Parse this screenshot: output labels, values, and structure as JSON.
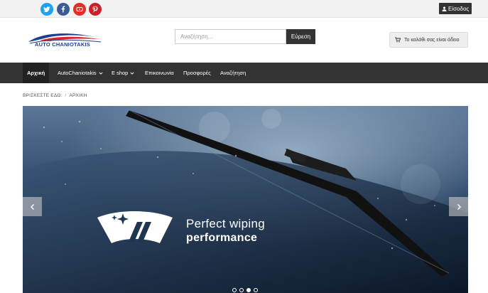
{
  "topbar": {
    "social": [
      {
        "name": "twitter-icon"
      },
      {
        "name": "facebook-icon"
      },
      {
        "name": "youtube-icon"
      },
      {
        "name": "pinterest-icon"
      }
    ],
    "login_label": "Είσοδος"
  },
  "header": {
    "logo_text_auto": "AUTO",
    "logo_text_brand": "CHANIOTAKIS",
    "search_placeholder": "Αναζήτηση...",
    "search_button": "Εύρεση",
    "cart_label": "Το καλάθι σας είναι άδειο"
  },
  "nav": {
    "items": [
      {
        "label": "Αρχική"
      },
      {
        "label": "AutoChaniotakis"
      },
      {
        "label": "E shop"
      },
      {
        "label": "Επικοινωνία"
      },
      {
        "label": "Προσφορές"
      },
      {
        "label": "Αναζήτηση"
      }
    ]
  },
  "breadcrumb": {
    "prefix": "ΒΡΙΣΚΕΣΤΕ ΕΔΩ:",
    "separator": "/",
    "current": "ΑΡΧΙΚΗ"
  },
  "slider": {
    "line1": "Perfect wiping",
    "line2": "performance",
    "slide_count": 4,
    "active_slide": 3
  },
  "colors": {
    "twitter": "#1da1f2",
    "facebook": "#3b5998",
    "youtube": "#e52d27",
    "pinterest": "#cb2027",
    "nav_bg": "#333333",
    "logo_blue": "#1a3f8f"
  }
}
